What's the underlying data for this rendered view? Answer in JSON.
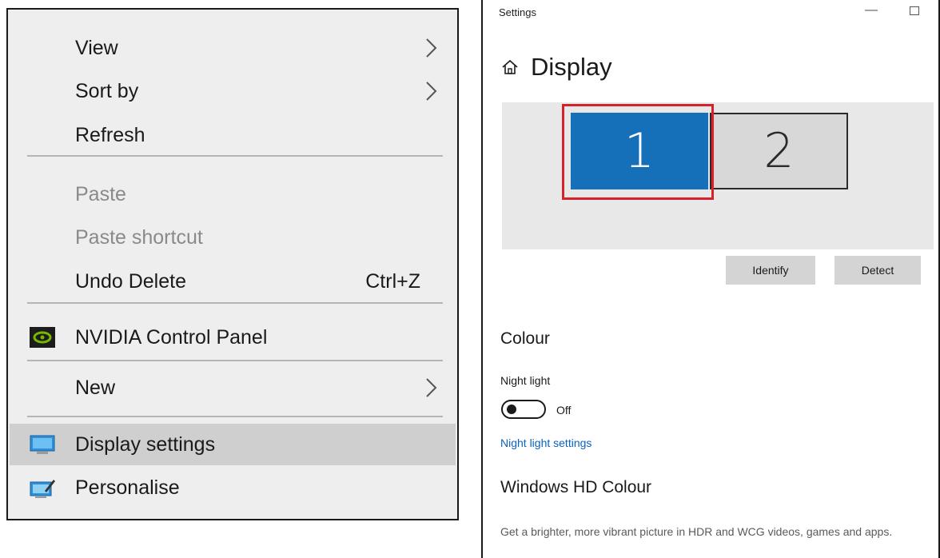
{
  "context_menu": {
    "items": {
      "view": {
        "label": "View",
        "submenu": true
      },
      "sort_by": {
        "label": "Sort by",
        "submenu": true
      },
      "refresh": {
        "label": "Refresh"
      },
      "paste": {
        "label": "Paste",
        "enabled": false
      },
      "paste_shortcut": {
        "label": "Paste shortcut",
        "enabled": false
      },
      "undo_delete": {
        "label": "Undo Delete",
        "shortcut": "Ctrl+Z"
      },
      "nvidia": {
        "label": "NVIDIA Control Panel",
        "icon": "nvidia-icon"
      },
      "new": {
        "label": "New",
        "submenu": true
      },
      "display_settings": {
        "label": "Display settings",
        "icon": "display-icon",
        "highlighted": true
      },
      "personalise": {
        "label": "Personalise",
        "icon": "personalise-icon"
      }
    }
  },
  "settings": {
    "window_title": "Settings",
    "page_title": "Display",
    "monitors": [
      {
        "number": "1",
        "selected": true
      },
      {
        "number": "2",
        "selected": false
      }
    ],
    "identify_label": "Identify",
    "detect_label": "Detect",
    "colour_heading": "Colour",
    "night_light_label": "Night light",
    "night_light_state": "Off",
    "night_light_link": "Night light settings",
    "hd_colour_heading": "Windows HD Colour",
    "hd_colour_desc": "Get a brighter, more vibrant picture in HDR and WCG videos, games and apps."
  },
  "colors": {
    "menu_bg": "#eeeeee",
    "highlight": "#cfcfcf",
    "monitor_selected": "#1670b9",
    "selection_outline": "#d6222b",
    "link": "#0a62c0"
  }
}
